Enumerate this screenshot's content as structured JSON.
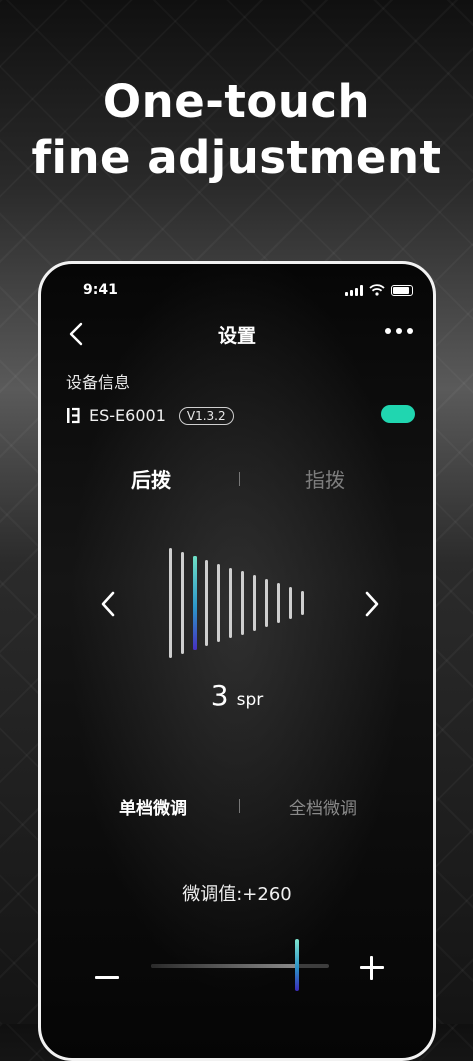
{
  "headline": {
    "line1": "One-touch",
    "line2": "fine adjustment"
  },
  "status_bar": {
    "time": "9:41"
  },
  "nav": {
    "title": "设置"
  },
  "device": {
    "section_label": "设备信息",
    "name": "ES-E6001",
    "version": "V1.3.2",
    "status_color": "#20d6b0"
  },
  "tabs": [
    {
      "label": "后拨",
      "selected": true
    },
    {
      "label": "指拨",
      "selected": false
    }
  ],
  "cassette": {
    "cog_count": 12,
    "selected_cog": 3
  },
  "gear": {
    "value": "3",
    "unit": "spr"
  },
  "modes": [
    {
      "label": "单档微调",
      "selected": true
    },
    {
      "label": "全档微调",
      "selected": false
    }
  ],
  "fine_tune": {
    "label": "微调值:+260",
    "level": 0.82
  },
  "colors": {
    "accent": "#20d6b0",
    "gradient_end": "#3a2ab8"
  }
}
